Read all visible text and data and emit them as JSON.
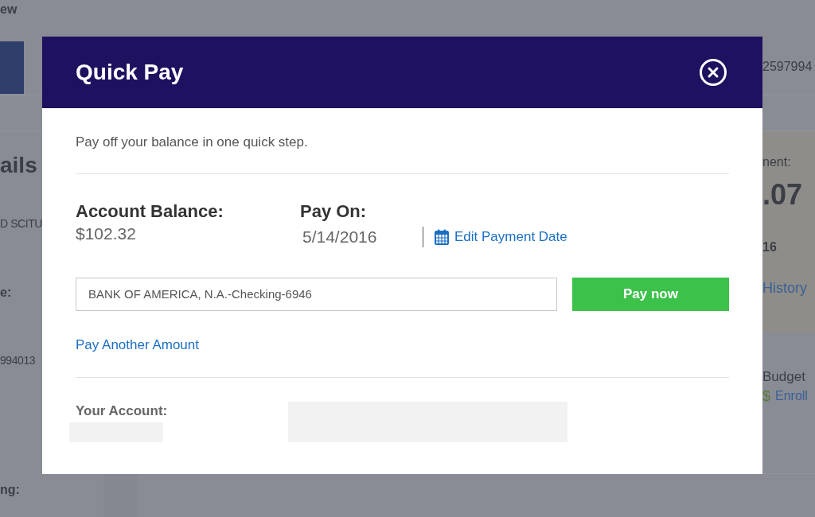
{
  "background": {
    "top_link": "ew",
    "account_number": "2597994",
    "left_items": [
      {
        "kind": "heading",
        "text": "ails"
      },
      {
        "kind": "value",
        "text": "D SCITU"
      },
      {
        "kind": "label",
        "text": "e:"
      },
      {
        "kind": "value",
        "text": "994013"
      },
      {
        "kind": "label",
        "text": "ng:"
      }
    ],
    "payment_panel": {
      "label": "nent:",
      "amount": ".07",
      "date": "16",
      "history_link": "History"
    },
    "budget": {
      "title": "Budget",
      "enroll_icon": "$",
      "enroll_link": "Enroll"
    }
  },
  "dialog": {
    "title": "Quick Pay",
    "intro": "Pay off your balance in one quick step.",
    "balance": {
      "label": "Account Balance:",
      "value": "$102.32"
    },
    "pay_on": {
      "label": "Pay On:",
      "date": "5/14/2016",
      "edit_link": "Edit Payment Date"
    },
    "account_select": {
      "value": "BANK OF AMERICA, N.A.-Checking-6946"
    },
    "pay_button": "Pay now",
    "other_amount_link": "Pay Another Amount",
    "your_account": {
      "label": "Your Account:"
    }
  }
}
